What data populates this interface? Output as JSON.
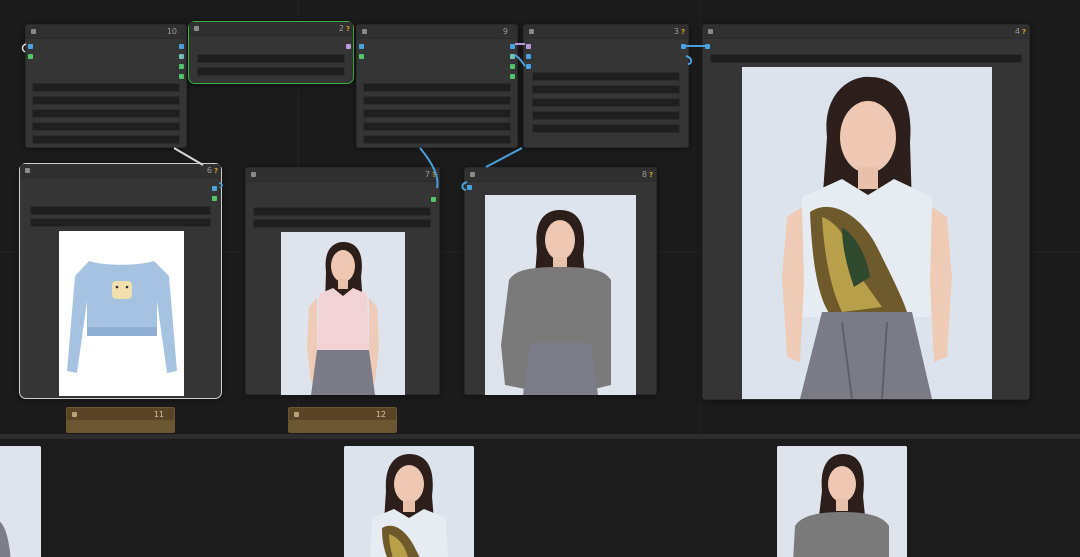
{
  "canvas": {
    "background": "#1b1b1b",
    "accent_selection": "#3fae3f"
  },
  "nodes": {
    "n10": {
      "id": "10",
      "badge": ""
    },
    "n2": {
      "id": "2",
      "badge": "?"
    },
    "n9": {
      "id": "9",
      "badge": ""
    },
    "n3": {
      "id": "3",
      "badge": "?"
    },
    "n4": {
      "id": "4",
      "badge": "?"
    },
    "n6": {
      "id": "6",
      "badge": "?",
      "image": "blue-cropped-sweater"
    },
    "n7": {
      "id": "7",
      "badge": "?",
      "image": "model-pink-top"
    },
    "n8": {
      "id": "8",
      "badge": "?",
      "image": "model-masked-top"
    },
    "n11": {
      "id": "11"
    },
    "n12": {
      "id": "12"
    }
  },
  "results": {
    "images": [
      "model-partial-left",
      "model-painted-top",
      "model-masked-top"
    ]
  },
  "colors": {
    "node_body": "#353535",
    "wire_blue": "#4a9fd8",
    "wire_white": "#d8d8d8",
    "port_blue": "#4aa3e0",
    "port_green": "#56c46a",
    "note": "#5c4a2c"
  }
}
